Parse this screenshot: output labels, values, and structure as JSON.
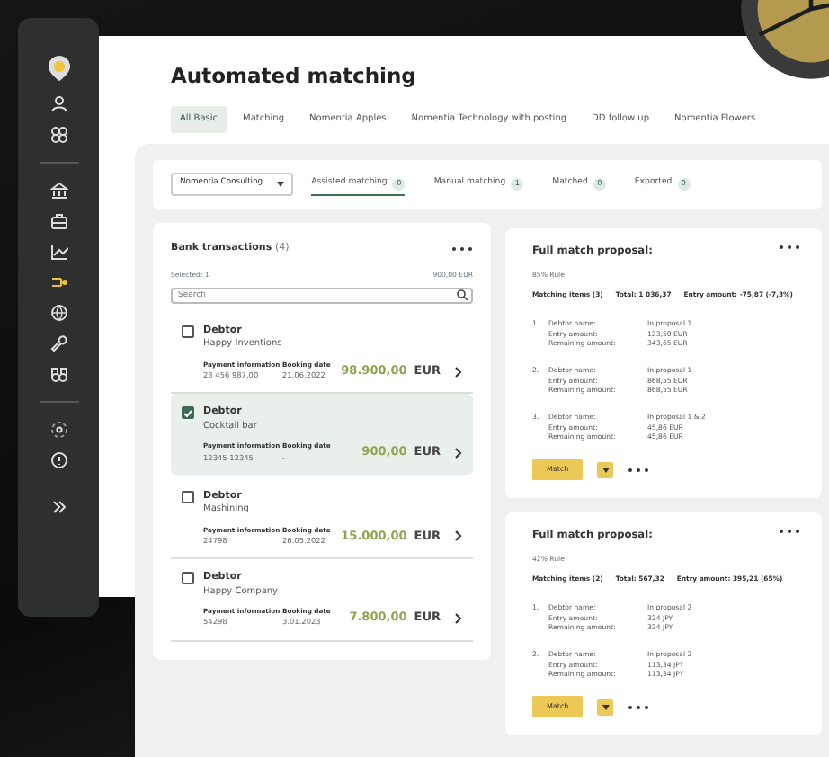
{
  "sidebar": {
    "groups": [
      {
        "items": [
          {
            "selected": false
          },
          {
            "selected": false
          }
        ]
      },
      {
        "items": [
          {
            "selected": false
          },
          {
            "selected": false
          },
          {
            "selected": false
          },
          {
            "selected": true
          },
          {
            "selected": false
          },
          {
            "selected": false
          },
          {
            "selected": false
          }
        ]
      },
      {
        "items": [
          {
            "selected": false
          },
          {
            "selected": false
          }
        ]
      }
    ]
  },
  "page": {
    "title": "Automated matching"
  },
  "tabs": [
    {
      "label": "All Basic",
      "selected": true
    },
    {
      "label": "Matching",
      "selected": false
    },
    {
      "label": "Nomentia Apples",
      "selected": false
    },
    {
      "label": "Nomentia Technology with posting",
      "selected": false
    },
    {
      "label": "DD follow up",
      "selected": false
    },
    {
      "label": "Nomentia Flowers",
      "selected": false
    }
  ],
  "filter": {
    "company": "Nomentia Consulting",
    "status_tabs": [
      {
        "label": "Assisted matching",
        "count": "0",
        "selected": true
      },
      {
        "label": "Manual matching",
        "count": "1",
        "selected": false
      },
      {
        "label": "Matched",
        "count": "0",
        "selected": false
      },
      {
        "label": "Exported",
        "count": "0",
        "selected": false
      }
    ]
  },
  "bank_transactions": {
    "title": "Bank transactions",
    "count": "(4)",
    "selected_label": "Selected: 1",
    "selected_total": "900,00 EUR",
    "search": {
      "placeholder": "Search"
    },
    "rows": [
      {
        "label": "Debtor",
        "name": "Happy Inventions",
        "payment_label": "Payment information",
        "payment_value": "23 456 987,00",
        "date_label": "Booking date",
        "date_value": "21.06.2022",
        "amount": "98.900,00",
        "currency": "EUR",
        "checked": false,
        "selected": false
      },
      {
        "label": "Debtor",
        "name": "Cocktail bar",
        "payment_label": "Payment information",
        "payment_value": "12345 12345",
        "date_label": "Booking date",
        "date_value": "-",
        "amount": "900,00",
        "currency": "EUR",
        "checked": true,
        "selected": true
      },
      {
        "label": "Debtor",
        "name": "Mashining",
        "payment_label": "Payment information",
        "payment_value": "24798",
        "date_label": "Booking date",
        "date_value": "26.05.2022",
        "amount": "15.000,00",
        "currency": "EUR",
        "checked": false,
        "selected": false
      },
      {
        "label": "Debtor",
        "name": "Happy Company",
        "payment_label": "Payment information",
        "payment_value": "54298",
        "date_label": "Booking date",
        "date_value": "3.01.2023",
        "amount": "7.800,00",
        "currency": "EUR",
        "checked": false,
        "selected": false
      }
    ]
  },
  "proposals": [
    {
      "title": "Full match proposal:",
      "rule": "85% Rule",
      "matching_items": "Matching items (3)",
      "total": "Total: 1 036,37",
      "entry_amount": "Entry amount: -75,87 (-7,3%)",
      "button": "Match",
      "items": [
        {
          "number": "1.",
          "lines": [
            [
              "Debtor name:",
              "In proposal 1"
            ],
            [
              "Entry amount:",
              "123,50 EUR"
            ],
            [
              "Remaining amount:",
              "343,65 EUR"
            ]
          ]
        },
        {
          "number": "2.",
          "lines": [
            [
              "Debtor name:",
              "In proposal 1"
            ],
            [
              "Entry amount:",
              "868,55 EUR"
            ],
            [
              "Remaining amount:",
              "868,55 EUR"
            ]
          ]
        },
        {
          "number": "3.",
          "lines": [
            [
              "Debtor name:",
              "In proposal 1 & 2"
            ],
            [
              "Entry amount:",
              "45,86 EUR"
            ],
            [
              "Remaining amount:",
              "45,86 EUR"
            ]
          ]
        }
      ]
    },
    {
      "title": "Full match proposal:",
      "rule": "42% Rule",
      "matching_items": "Matching items (2)",
      "total": "Total: 567,32",
      "entry_amount": "Entry amount: 395,21 (65%)",
      "button": "Match",
      "items": [
        {
          "number": "1.",
          "lines": [
            [
              "Debtor name:",
              "In proposal 2"
            ],
            [
              "Entry amount:",
              "324 JPY"
            ],
            [
              "Remaining amount:",
              "324 JPY"
            ]
          ]
        },
        {
          "number": "2.",
          "lines": [
            [
              "Debtor name:",
              "In proposal 2"
            ],
            [
              "Entry amount:",
              "113,34 JPY"
            ],
            [
              "Remaining amount:",
              "113,34 JPY"
            ]
          ]
        }
      ]
    }
  ]
}
